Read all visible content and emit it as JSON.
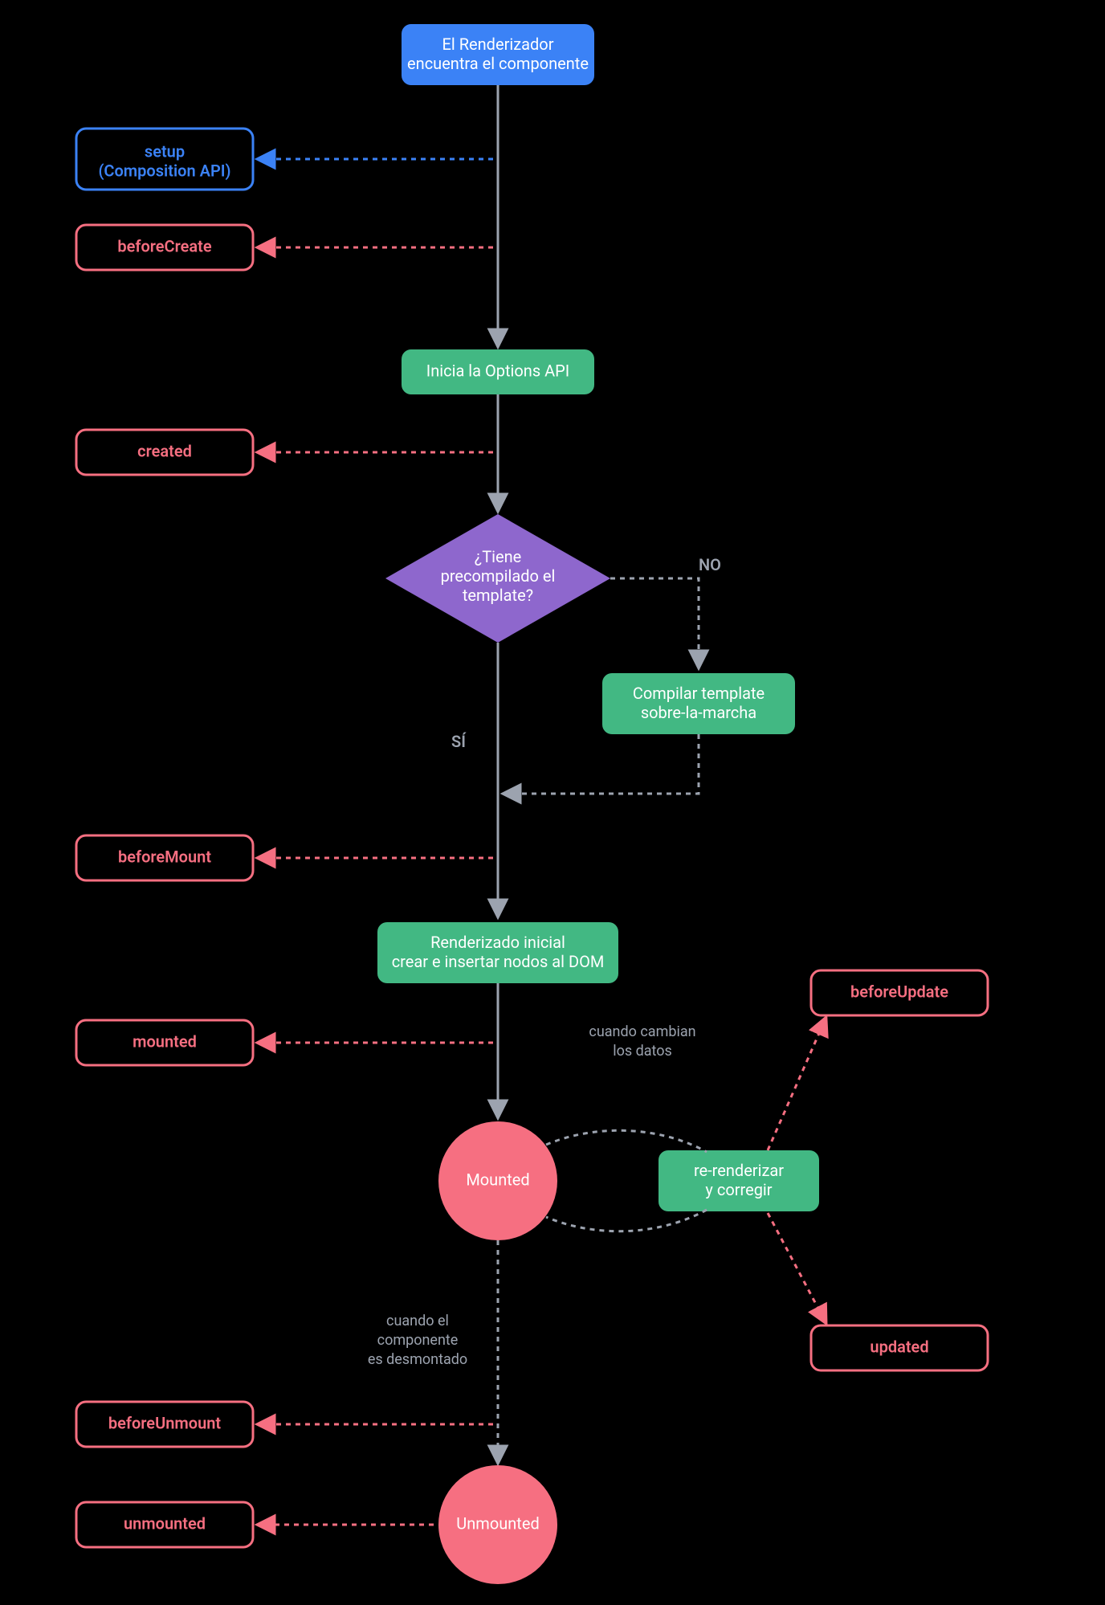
{
  "colors": {
    "blue": "#3b82f6",
    "green": "#42b883",
    "purple": "#8e67cd",
    "red": "#f66f81",
    "gray": "#9ca3af"
  },
  "nodes": {
    "start": {
      "line1": "El Renderizador",
      "line2": "encuentra el componente"
    },
    "optionsApi": "Inicia la Options API",
    "decision": {
      "line1": "¿Tiene",
      "line2": "precompilado el",
      "line3": "template?"
    },
    "compile": {
      "line1": "Compilar template",
      "line2": "sobre-la-marcha"
    },
    "initialRender": {
      "line1": "Renderizado inicial",
      "line2": "crear e insertar nodos al DOM"
    },
    "mounted": "Mounted",
    "rerender": {
      "line1": "re-renderizar",
      "line2": "y corregir"
    },
    "unmounted": "Unmounted"
  },
  "hooks": {
    "setup": {
      "line1": "setup",
      "line2": "(Composition API)"
    },
    "beforeCreate": "beforeCreate",
    "created": "created",
    "beforeMount": "beforeMount",
    "mounted": "mounted",
    "beforeUpdate": "beforeUpdate",
    "updated": "updated",
    "beforeUnmount": "beforeUnmount",
    "unmounted": "unmounted"
  },
  "labels": {
    "no": "NO",
    "yes": "SÍ",
    "dataChanges": {
      "line1": "cuando cambian",
      "line2": "los datos"
    },
    "unmountWhen": {
      "line1": "cuando el",
      "line2": "componente",
      "line3": "es desmontado"
    }
  }
}
